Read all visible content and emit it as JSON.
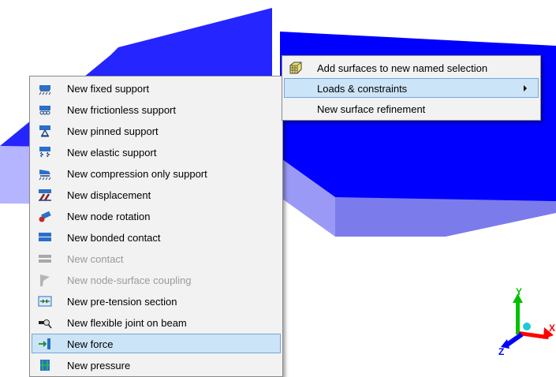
{
  "context_menu": {
    "items": [
      {
        "label": "Add surfaces to new named selection",
        "icon": "named-selection-icon"
      },
      {
        "label": "Loads & constraints",
        "icon": "none",
        "submenu": true
      },
      {
        "label": "New surface refinement",
        "icon": "none"
      }
    ]
  },
  "submenu": {
    "items": [
      {
        "label": "New fixed support",
        "icon": "fixed-support-icon"
      },
      {
        "label": "New frictionless support",
        "icon": "frictionless-support-icon"
      },
      {
        "label": "New pinned support",
        "icon": "pinned-support-icon"
      },
      {
        "label": "New elastic support",
        "icon": "elastic-support-icon"
      },
      {
        "label": "New compression only support",
        "icon": "compression-only-support-icon"
      },
      {
        "label": "New displacement",
        "icon": "displacement-icon"
      },
      {
        "label": "New node rotation",
        "icon": "node-rotation-icon"
      },
      {
        "label": "New bonded contact",
        "icon": "bonded-contact-icon"
      },
      {
        "label": "New contact",
        "icon": "contact-icon",
        "disabled": true
      },
      {
        "label": "New node-surface coupling",
        "icon": "node-surface-coupling-icon",
        "disabled": true
      },
      {
        "label": "New pre-tension section",
        "icon": "pre-tension-section-icon"
      },
      {
        "label": "New flexible joint on beam",
        "icon": "flexible-joint-icon"
      },
      {
        "label": "New force",
        "icon": "force-icon",
        "highlighted": true
      },
      {
        "label": "New pressure",
        "icon": "pressure-icon"
      }
    ]
  },
  "axis_triad": {
    "x": "X",
    "y": "Y",
    "z": "Z"
  },
  "colors": {
    "model_top": "#0000ff",
    "model_side_light": "#b0b0ff",
    "model_side_mid": "#8080f0",
    "menu_bg": "#f2f2f2",
    "highlight": "#cce4f7",
    "axis_x": "#ff0000",
    "axis_y": "#00c000",
    "axis_z": "#0000ff"
  }
}
